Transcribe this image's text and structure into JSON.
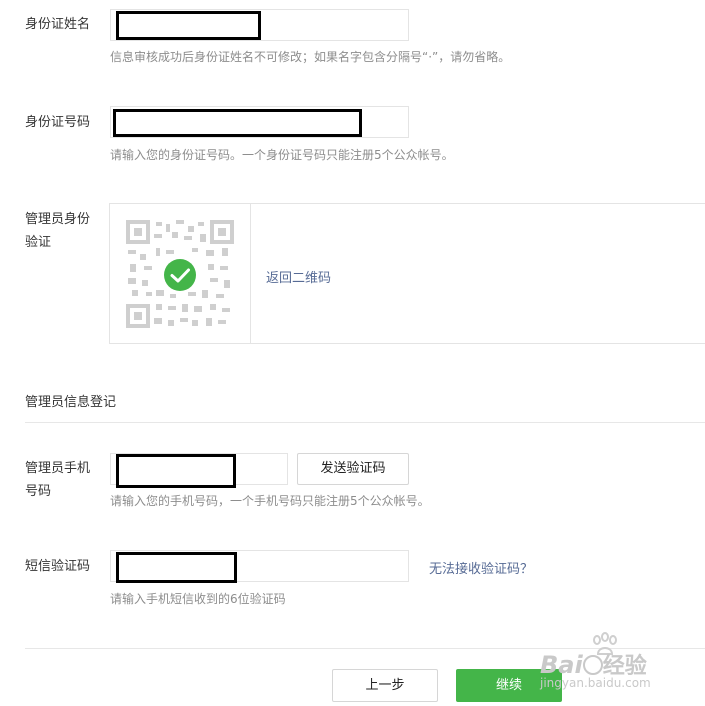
{
  "form": {
    "id_name": {
      "label": "身份证姓名",
      "hint": "信息审核成功后身份证姓名不可修改；如果名字包含分隔号“·”，请勿省略。"
    },
    "id_number": {
      "label": "身份证号码",
      "hint": "请输入您的身份证号码。一个身份证号码只能注册5个公众帐号。"
    },
    "admin_verify": {
      "label_line1": "管理员身份",
      "label_line2": "验证",
      "return_qr_link": "返回二维码"
    },
    "section_title": "管理员信息登记",
    "admin_phone": {
      "label_line1": "管理员手机",
      "label_line2": "号码",
      "send_code_button": "发送验证码",
      "hint": "请输入您的手机号码，一个手机号码只能注册5个公众帐号。"
    },
    "sms_code": {
      "label": "短信验证码",
      "cannot_receive_link": "无法接收验证码？",
      "hint": "请输入手机短信收到的6位验证码"
    }
  },
  "footer": {
    "prev_button": "上一步",
    "continue_button": "继续"
  },
  "watermark": {
    "brand": "Bai",
    "brand_suffix": "经验",
    "url": "jingyan.baidu.com"
  },
  "colors": {
    "primary_green": "#44b549",
    "link_blue": "#576b95",
    "hint_gray": "#8d8d8d",
    "border_gray": "#e4e4e4"
  }
}
